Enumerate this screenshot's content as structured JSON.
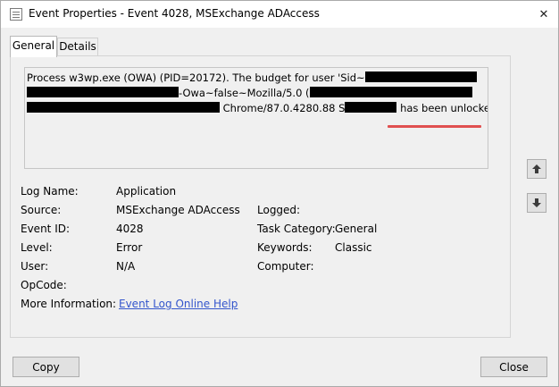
{
  "window": {
    "title": "Event Properties - Event 4028, MSExchange ADAccess",
    "close_glyph": "✕"
  },
  "tabs": [
    {
      "label": "General",
      "active": true
    },
    {
      "label": "Details",
      "active": false
    }
  ],
  "description": {
    "line1": "Process w3wp.exe (OWA) (PID=20172). The budget for user 'Sid~",
    "line2_mid": "-Owa~false~Mozilla/5.0 (",
    "line3_mid": "Chrome/87.0.4280.88 S",
    "line3_end": "has been unlocked."
  },
  "properties": {
    "log_name": {
      "label": "Log Name:",
      "value": "Application"
    },
    "source": {
      "label": "Source:",
      "value": "MSExchange ADAccess"
    },
    "logged": {
      "label": "Logged:",
      "value": ""
    },
    "event_id": {
      "label": "Event ID:",
      "value": "4028"
    },
    "task_category": {
      "label": "Task Category:",
      "value": "General"
    },
    "level": {
      "label": "Level:",
      "value": "Error"
    },
    "keywords": {
      "label": "Keywords:",
      "value": "Classic"
    },
    "user": {
      "label": "User:",
      "value": "N/A"
    },
    "computer": {
      "label": "Computer:",
      "value": ""
    },
    "opcode": {
      "label": "OpCode:",
      "value": ""
    },
    "more_info": {
      "label": "More Information:",
      "link": "Event Log Online Help"
    }
  },
  "buttons": {
    "copy": "Copy",
    "close": "Close"
  },
  "colors": {
    "link": "#3355cc",
    "highlight_underline": "#e05050"
  }
}
